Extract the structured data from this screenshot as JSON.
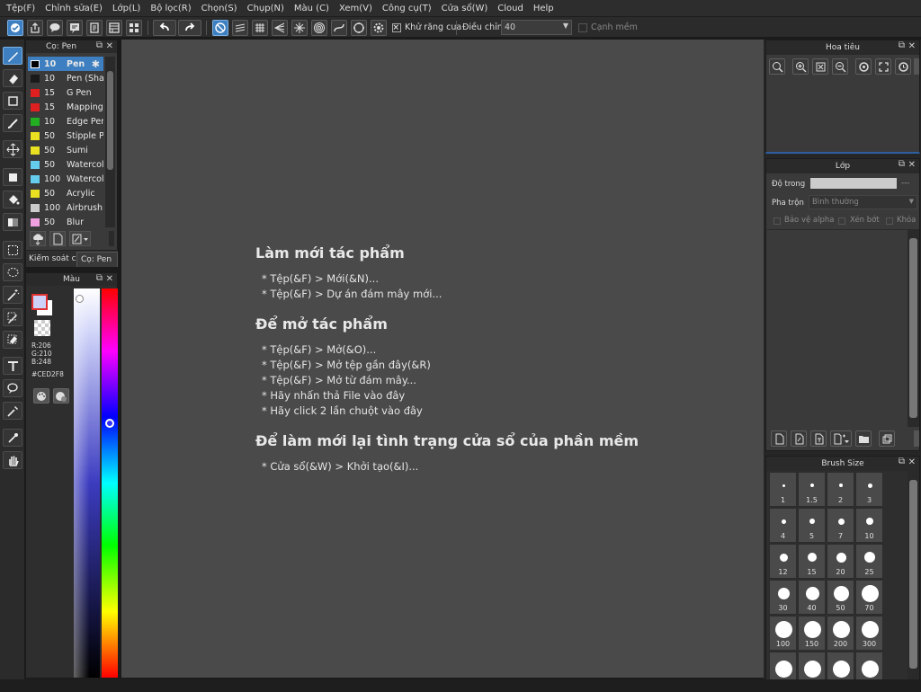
{
  "menu": [
    "Tệp(F)",
    "Chỉnh sửa(E)",
    "Lớp(L)",
    "Bộ lọc(R)",
    "Chọn(S)",
    "Chụp(N)",
    "Màu (C)",
    "Xem(V)",
    "Công cụ(T)",
    "Cửa sổ(W)",
    "Cloud",
    "Help"
  ],
  "toolbar": {
    "antialias_label": "Khử răng cưa",
    "adjust_label": "Điều chỉnh",
    "adjust_value": "40",
    "soft_edge_label": "Cạnh mềm"
  },
  "brush_panel": {
    "title": "Cọ: Pen",
    "brushes": [
      {
        "size": "10",
        "name": "Pen",
        "color": "#000000"
      },
      {
        "size": "10",
        "name": "Pen (Sha",
        "color": "#1a1a1a"
      },
      {
        "size": "15",
        "name": "G Pen",
        "color": "#e02020"
      },
      {
        "size": "15",
        "name": "Mapping I",
        "color": "#e02020"
      },
      {
        "size": "10",
        "name": "Edge Pen",
        "color": "#22b022"
      },
      {
        "size": "50",
        "name": "Stipple Pe",
        "color": "#e8e020"
      },
      {
        "size": "50",
        "name": "Sumi",
        "color": "#e8e020"
      },
      {
        "size": "50",
        "name": "Watercolo",
        "color": "#66ccee"
      },
      {
        "size": "100",
        "name": "Watercolo",
        "color": "#66ccee"
      },
      {
        "size": "50",
        "name": "Acrylic",
        "color": "#e8e020"
      },
      {
        "size": "100",
        "name": "Airbrush",
        "color": "#cccccc"
      },
      {
        "size": "50",
        "name": "Blur",
        "color": "#f0a0e0"
      }
    ],
    "tabs": [
      "Kiểm soát cọ",
      "Cọ: Pen"
    ]
  },
  "color_panel": {
    "title": "Màu",
    "r": "R:206",
    "g": "G:210",
    "b": "B:248",
    "hex": "#CED2F8",
    "fg_color": "#CED2F8"
  },
  "canvas_text": {
    "h1": "Làm mới tác phẩm",
    "h1_lines": [
      "* Tệp(&F) > Mới(&N)...",
      "* Tệp(&F) > Dự án đám mây mới..."
    ],
    "h2": "Để mở tác phẩm",
    "h2_lines": [
      "* Tệp(&F) > Mở(&O)...",
      "* Tệp(&F) > Mở tệp gần đây(&R)",
      "* Tệp(&F) > Mở từ đám mây...",
      "* Hãy nhấn thả File vào đây",
      "* Hãy click 2 lần chuột vào đây"
    ],
    "h3": "Để làm mới lại tình trạng cửa sổ của phần mềm",
    "h3_lines": [
      "* Cửa sổ(&W) > Khởi tạo(&I)..."
    ]
  },
  "navigator": {
    "title": "Hoa tiêu"
  },
  "layer_panel": {
    "title": "Lớp",
    "opacity_label": "Độ trong",
    "opacity_value": "---",
    "blend_label": "Pha trộn",
    "blend_value": "Bình thường",
    "protect_alpha": "Bảo vệ alpha",
    "clipping": "Xén bớt",
    "lock": "Khóa"
  },
  "brush_size_panel": {
    "title": "Brush Size",
    "sizes": [
      "1",
      "1.5",
      "2",
      "3",
      "4",
      "5",
      "7",
      "10",
      "12",
      "15",
      "20",
      "25",
      "30",
      "40",
      "50",
      "70",
      "100",
      "150",
      "200",
      "300",
      "",
      "",
      "",
      ""
    ]
  }
}
